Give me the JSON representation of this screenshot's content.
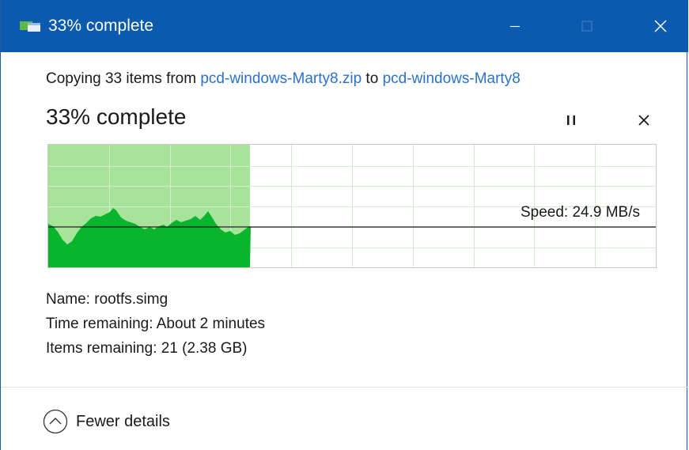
{
  "window": {
    "title": "33% complete"
  },
  "copy": {
    "prefix": "Copying 33 items from ",
    "source": "pcd-windows-Marty8.zip",
    "middle": " to ",
    "destination": "pcd-windows-Marty8"
  },
  "progress": {
    "headline": "33% complete",
    "fraction": 0.33,
    "speed_label": "Speed: 24.9 MB/s"
  },
  "details": {
    "name": "Name: rootfs.simg",
    "time_remaining": "Time remaining: About 2 minutes",
    "items_remaining": "Items remaining: 21 (2.38 GB)"
  },
  "footer": {
    "toggle_label": "Fewer details"
  },
  "colors": {
    "titlebar": "#0a5bb0",
    "progress_fill": "#a8e39a",
    "speed_fill": "#08b52c",
    "link": "#2a71c9"
  },
  "icons": {
    "app": "copy-files-icon",
    "minimize": "minimize-icon",
    "maximize": "maximize-icon",
    "close": "close-icon",
    "pause": "pause-icon",
    "cancel": "cancel-icon",
    "collapse": "chevron-up-circle-icon"
  }
}
